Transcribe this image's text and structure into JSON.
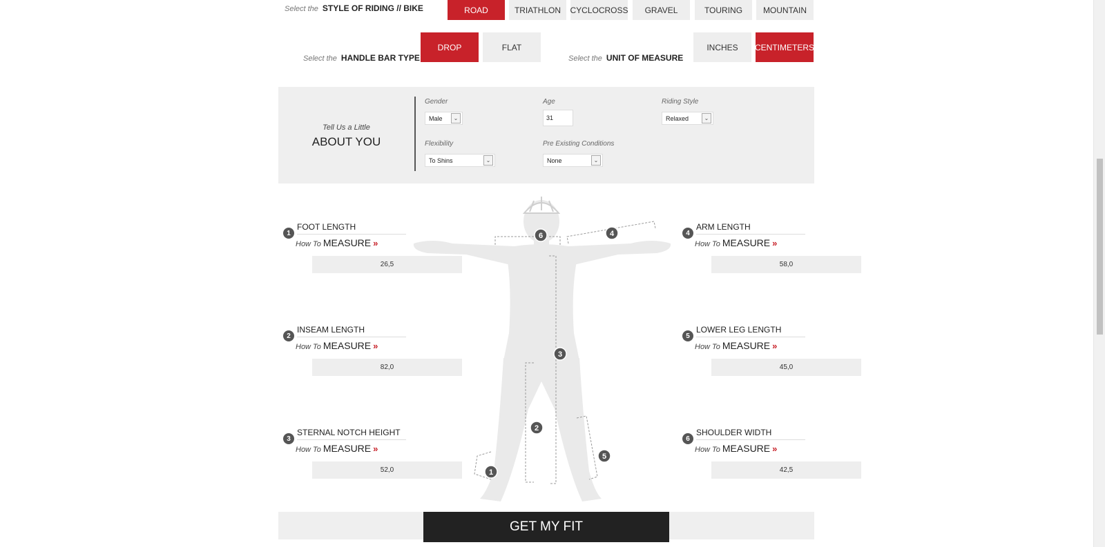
{
  "style": {
    "prefix": "Select the",
    "label": "STYLE OF RIDING // BIKE",
    "options": [
      "ROAD",
      "TRIATHLON",
      "CYCLOCROSS",
      "GRAVEL",
      "TOURING",
      "MOUNTAIN"
    ],
    "selected": "ROAD"
  },
  "handlebar": {
    "prefix": "Select the",
    "label": "HANDLE BAR TYPE",
    "options": [
      "DROP",
      "FLAT"
    ],
    "selected": "DROP"
  },
  "unit": {
    "prefix": "Select the",
    "label": "UNIT OF MEASURE",
    "options": [
      "INCHES",
      "CENTIMETERS"
    ],
    "selected": "CENTIMETERS"
  },
  "about": {
    "small": "Tell Us a Little",
    "big": "ABOUT YOU",
    "gender_label": "Gender",
    "gender_value": "Male",
    "age_label": "Age",
    "age_value": "31",
    "riding_label": "Riding Style",
    "riding_value": "Relaxed",
    "flex_label": "Flexibility",
    "flex_value": "To Shins",
    "pre_label": "Pre Existing Conditions",
    "pre_value": "None"
  },
  "howto": {
    "prefix": "How To",
    "word": "MEASURE",
    "chevron": "»"
  },
  "measurements": [
    {
      "num": "1",
      "title": "FOOT LENGTH",
      "value": "26,5"
    },
    {
      "num": "2",
      "title": "INSEAM LENGTH",
      "value": "82,0"
    },
    {
      "num": "3",
      "title": "STERNAL NOTCH HEIGHT",
      "value": "52,0"
    },
    {
      "num": "4",
      "title": "ARM LENGTH",
      "value": "58,0"
    },
    {
      "num": "5",
      "title": "LOWER LEG LENGTH",
      "value": "45,0"
    },
    {
      "num": "6",
      "title": "SHOULDER  WIDTH",
      "value": "42,5"
    }
  ],
  "figure_markers": [
    "1",
    "2",
    "3",
    "4",
    "5",
    "6"
  ],
  "cta": "GET MY FIT",
  "colors": {
    "accent": "#c8222a",
    "panel": "#efefef",
    "button": "#222222"
  }
}
